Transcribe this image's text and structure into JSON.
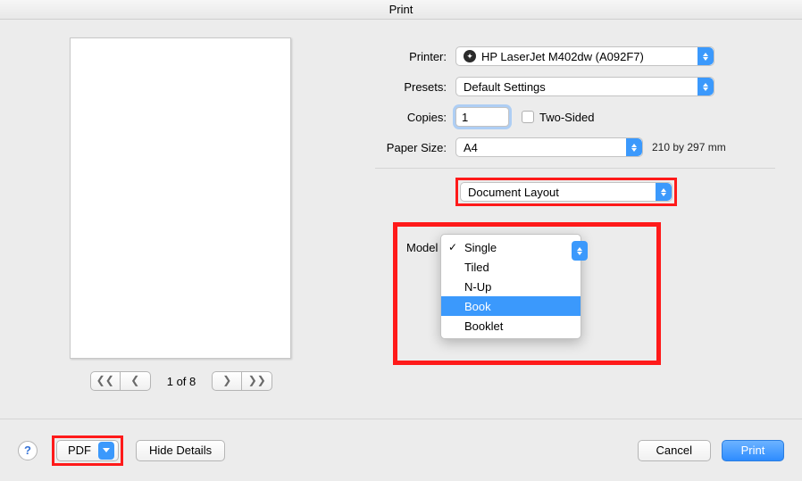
{
  "title": "Print",
  "preview": {
    "pager_label": "1 of 8"
  },
  "settings": {
    "printer_label": "Printer:",
    "printer_value": "HP LaserJet M402dw (A092F7)",
    "presets_label": "Presets:",
    "presets_value": "Default Settings",
    "copies_label": "Copies:",
    "copies_value": "1",
    "two_sided_label": "Two-Sided",
    "paper_size_label": "Paper Size:",
    "paper_size_value": "A4",
    "paper_size_note": "210 by 297 mm",
    "section_value": "Document Layout",
    "model_label": "Model"
  },
  "model_options": {
    "opt0": "Single",
    "opt1": "Tiled",
    "opt2": "N-Up",
    "opt3": "Book",
    "opt4": "Booklet"
  },
  "footer": {
    "pdf_label": "PDF",
    "hide_details": "Hide Details",
    "cancel": "Cancel",
    "print": "Print"
  }
}
